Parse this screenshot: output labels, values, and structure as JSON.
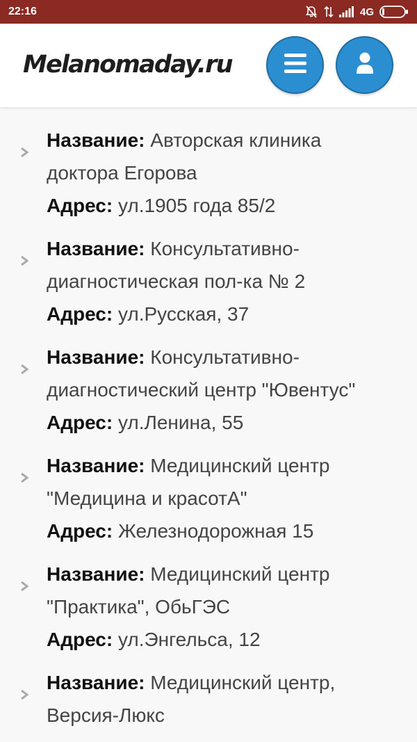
{
  "status_bar": {
    "time": "22:16",
    "network": "4G",
    "icons": [
      "mute-icon",
      "data-arrows-icon",
      "signal-icon",
      "battery-icon"
    ]
  },
  "header": {
    "logo": "Melanomaday.ru",
    "menu_icon": "hamburger-menu-icon",
    "user_icon": "user-icon",
    "button_color": "#2a8ed1"
  },
  "labels": {
    "name": "Название:",
    "address": "Адрес:"
  },
  "clinics": [
    {
      "name": "Авторская клиника доктора Егорова",
      "address": "ул.1905 года 85/2"
    },
    {
      "name": "Консультативно-диагностическая пол-ка № 2",
      "address": "ул.Русская, 37"
    },
    {
      "name": "Консультативно-диагностический центр \"Ювентус\"",
      "address": "ул.Ленина, 55"
    },
    {
      "name": "Медицинский центр \"Медицина и красотА\"",
      "address": "Железнодорожная 15"
    },
    {
      "name": "Медицинский центр \"Практика\", ОбьГЭС",
      "address": "ул.Энгельса, 12"
    },
    {
      "name": "Медицинский центр, Версия-Люкс",
      "address": ""
    }
  ]
}
